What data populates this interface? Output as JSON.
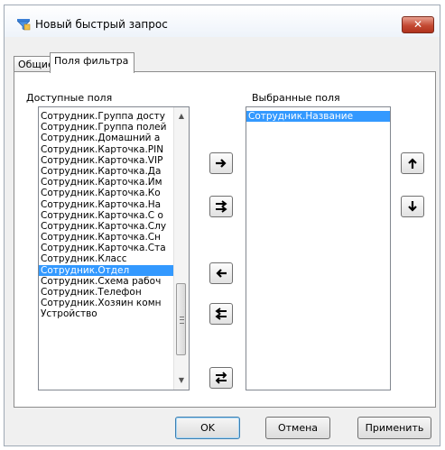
{
  "window": {
    "title": "Новый быстрый запрос",
    "close_symbol": "✕"
  },
  "tabs": [
    {
      "label": "Общие",
      "active": false
    },
    {
      "label": "Поля фильтра",
      "active": true
    }
  ],
  "available": {
    "label": "Доступные поля",
    "items": [
      "Сотрудник.Группа досту",
      "Сотрудник.Группа полей",
      "Сотрудник.Домашний а",
      "Сотрудник.Карточка.PIN",
      "Сотрудник.Карточка.VIP",
      "Сотрудник.Карточка.Да",
      "Сотрудник.Карточка.Им",
      "Сотрудник.Карточка.Ко",
      "Сотрудник.Карточка.На",
      "Сотрудник.Карточка.С о",
      "Сотрудник.Карточка.Слу",
      "Сотрудник.Карточка.Сн",
      "Сотрудник.Карточка.Ста",
      "Сотрудник.Класс",
      "Сотрудник.Отдел",
      "Сотрудник.Схема рабоч",
      "Сотрудник.Телефон",
      "Сотрудник.Хозяин комн",
      "Устройство"
    ],
    "selected_index": 14
  },
  "selected": {
    "label": "Выбранные поля",
    "items": [
      "Сотрудник.Название"
    ],
    "selected_index": 0
  },
  "transfer_buttons": [
    {
      "name": "add-one-button",
      "icon": "arrow-right-icon"
    },
    {
      "name": "add-all-button",
      "icon": "double-arrow-right-icon"
    },
    {
      "name": "remove-one-button",
      "icon": "arrow-left-icon"
    },
    {
      "name": "remove-all-button",
      "icon": "double-arrow-left-icon"
    },
    {
      "name": "swap-button",
      "icon": "swap-arrows-icon"
    }
  ],
  "order_buttons": [
    {
      "name": "move-up-button",
      "icon": "arrow-up-icon"
    },
    {
      "name": "move-down-button",
      "icon": "arrow-down-icon"
    }
  ],
  "footer": {
    "ok_label": "OK",
    "cancel_label": "Отмена",
    "apply_label": "Применить"
  },
  "colors": {
    "selection": "#3399ff",
    "close_button": "#c44a33"
  }
}
